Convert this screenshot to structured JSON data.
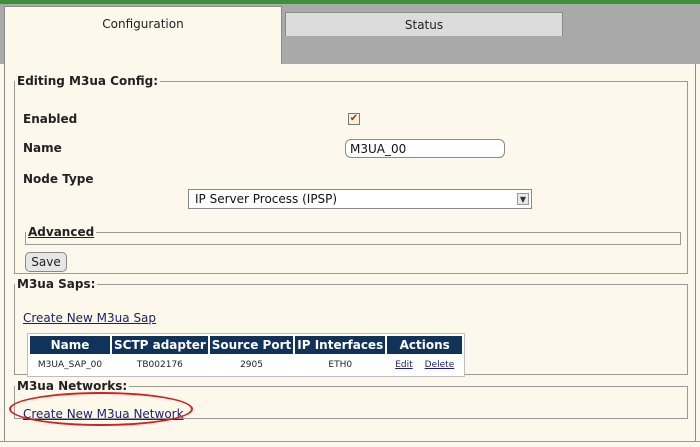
{
  "tabs": [
    {
      "label": "Configuration",
      "active": true
    },
    {
      "label": "Status",
      "active": false
    }
  ],
  "edit": {
    "legend": "Editing M3ua Config:",
    "enabled_label": "Enabled",
    "enabled_checked": true,
    "name_label": "Name",
    "name_value": "M3UA_00",
    "node_type_label": "Node Type",
    "node_type_selected": "IP Server Process (IPSP)",
    "advanced_label": "Advanced",
    "save_label": "Save"
  },
  "saps": {
    "legend": "M3ua Saps:",
    "create_link": "Create New M3ua Sap",
    "columns": [
      "Name",
      "SCTP adapter",
      "Source Port",
      "IP Interfaces",
      "Actions"
    ],
    "rows": [
      {
        "name": "M3UA_SAP_00",
        "sctp": "TB002176",
        "port": "2905",
        "ip": "ETH0",
        "edit": "Edit",
        "delete": "Delete"
      }
    ]
  },
  "networks": {
    "legend": "M3ua Networks:",
    "create_link": "Create New M3ua Network"
  },
  "colors": {
    "header_band": "#a9a9a9",
    "page_bg": "#fdf8ec",
    "table_header": "#11335a",
    "highlight_ellipse": "#d42020"
  }
}
